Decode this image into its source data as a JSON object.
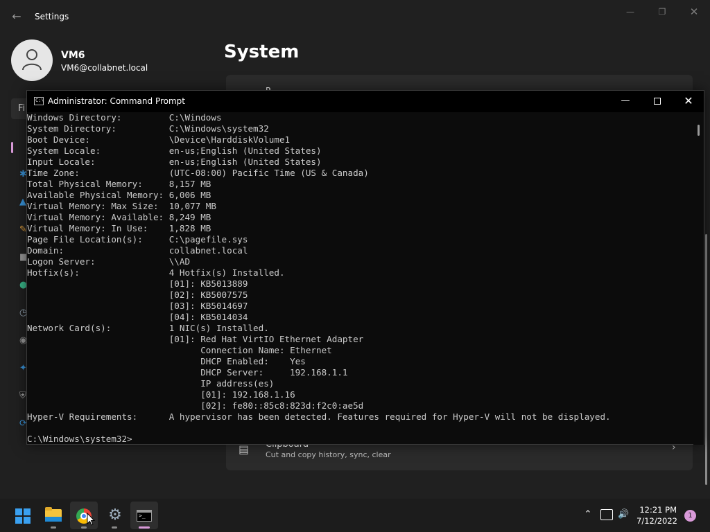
{
  "settings": {
    "app_title": "Settings",
    "user_name": "VM6",
    "user_email": "VM6@collabnet.local",
    "search_partial": "Fi",
    "page_title": "System",
    "card_top_partial": "P",
    "clipboard_title": "Clipboard",
    "clipboard_subtitle": "Cut and copy history, sync, clear",
    "accent_color": "#d99ad9"
  },
  "cmd": {
    "title": "Administrator: Command Prompt",
    "lines": [
      "Windows Directory:         C:\\Windows",
      "System Directory:          C:\\Windows\\system32",
      "Boot Device:               \\Device\\HarddiskVolume1",
      "System Locale:             en-us;English (United States)",
      "Input Locale:              en-us;English (United States)",
      "Time Zone:                 (UTC-08:00) Pacific Time (US & Canada)",
      "Total Physical Memory:     8,157 MB",
      "Available Physical Memory: 6,006 MB",
      "Virtual Memory: Max Size:  10,077 MB",
      "Virtual Memory: Available: 8,249 MB",
      "Virtual Memory: In Use:    1,828 MB",
      "Page File Location(s):     C:\\pagefile.sys",
      "Domain:                    collabnet.local",
      "Logon Server:              \\\\AD",
      "Hotfix(s):                 4 Hotfix(s) Installed.",
      "                           [01]: KB5013889",
      "                           [02]: KB5007575",
      "                           [03]: KB5014697",
      "                           [04]: KB5014034",
      "Network Card(s):           1 NIC(s) Installed.",
      "                           [01]: Red Hat VirtIO Ethernet Adapter",
      "                                 Connection Name: Ethernet",
      "                                 DHCP Enabled:    Yes",
      "                                 DHCP Server:     192.168.1.1",
      "                                 IP address(es)",
      "                                 [01]: 192.168.1.16",
      "                                 [02]: fe80::85c8:823d:f2c0:ae5d",
      "Hyper-V Requirements:      A hypervisor has been detected. Features required for Hyper-V will not be displayed.",
      "",
      "C:\\Windows\\system32>"
    ]
  },
  "taskbar": {
    "apps": [
      {
        "name": "Start",
        "icon": "windows-logo-icon"
      },
      {
        "name": "File Explorer",
        "icon": "folder-icon"
      },
      {
        "name": "Google Chrome",
        "icon": "chrome-icon"
      },
      {
        "name": "Settings",
        "icon": "gear-icon"
      },
      {
        "name": "Command Prompt",
        "icon": "terminal-icon"
      }
    ],
    "time": "12:21 PM",
    "date": "7/12/2022",
    "notification_count": "1"
  }
}
